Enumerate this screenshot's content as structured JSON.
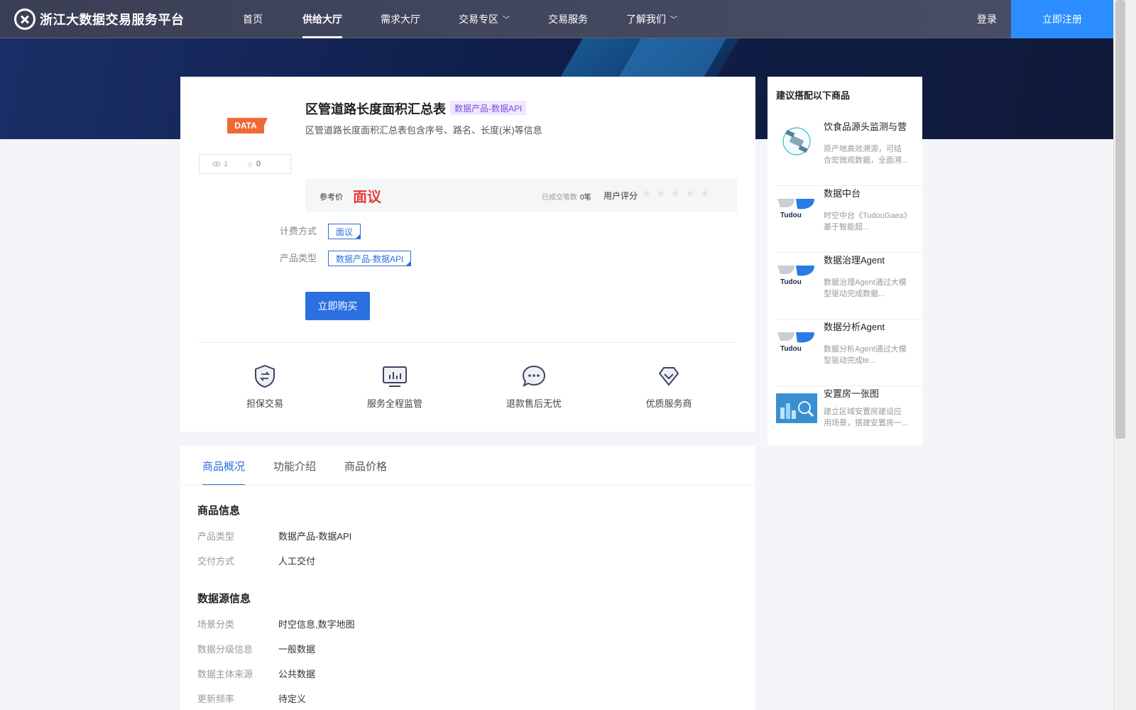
{
  "header": {
    "logo_text": "浙江大数据交易服务平台",
    "nav": [
      {
        "label": "首页"
      },
      {
        "label": "供给大厅"
      },
      {
        "label": "需求大厅"
      },
      {
        "label": "交易专区"
      },
      {
        "label": "交易服务"
      },
      {
        "label": "了解我们"
      }
    ],
    "login": "登录",
    "register": "立即注册"
  },
  "product": {
    "badge": "DATA",
    "views": "1",
    "stars": "0",
    "title": "区管道路长度面积汇总表",
    "tag": "数据产品-数据API",
    "description": "区管道路长度面积汇总表包含序号、路名、长度(米)等信息",
    "price_label": "参考价",
    "price": "面议",
    "deals_label": "已成交笔数",
    "deals": "0笔",
    "rating_label": "用户评分",
    "rating_stars": "★★★★★",
    "billing_label": "计费方式",
    "billing_value": "面议",
    "type_label": "产品类型",
    "type_value": "数据产品-数据API",
    "buy": "立即购买"
  },
  "features": [
    {
      "label": "担保交易",
      "icon": "shield-exchange-icon"
    },
    {
      "label": "服务全程监管",
      "icon": "monitor-chart-icon"
    },
    {
      "label": "退款售后无忧",
      "icon": "chat-bubble-icon"
    },
    {
      "label": "优质服务商",
      "icon": "diamond-icon"
    }
  ],
  "recommend": {
    "title": "建议搭配以下商品",
    "items": [
      {
        "name": "饮食品源头监测与营",
        "desc": "原产地高效溯源，可结合宏微观数据，全面溯..."
      },
      {
        "name": "数据中台",
        "desc": "时空中台《TudouGaea》基于智能超..."
      },
      {
        "name": "数据治理Agent",
        "desc": "数据治理Agent通过大模型驱动完成数据..."
      },
      {
        "name": "数据分析Agent",
        "desc": "数据分析Agent通过大模型驱动完成te..."
      },
      {
        "name": "安置房一张图",
        "desc": "建立区域安置房建设应用场景，搭建安置房一..."
      }
    ],
    "tudou_text": "Tudou"
  },
  "detail": {
    "tabs": [
      "商品概况",
      "功能介绍",
      "商品价格"
    ],
    "sections": [
      {
        "title": "商品信息",
        "rows": [
          {
            "label": "产品类型",
            "value": "数据产品-数据API"
          },
          {
            "label": "交付方式",
            "value": "人工交付"
          }
        ]
      },
      {
        "title": "数据源信息",
        "rows": [
          {
            "label": "场景分类",
            "value": "时空信息,数字地图"
          },
          {
            "label": "数据分级信息",
            "value": "一般数据"
          },
          {
            "label": "数据主体来源",
            "value": "公共数据"
          },
          {
            "label": "更新频率",
            "value": "待定义"
          }
        ]
      }
    ]
  },
  "colors": {
    "accent": "#2c6fe0",
    "price": "#e43a3a",
    "badge": "#f06a35",
    "register": "#2b8dff"
  }
}
